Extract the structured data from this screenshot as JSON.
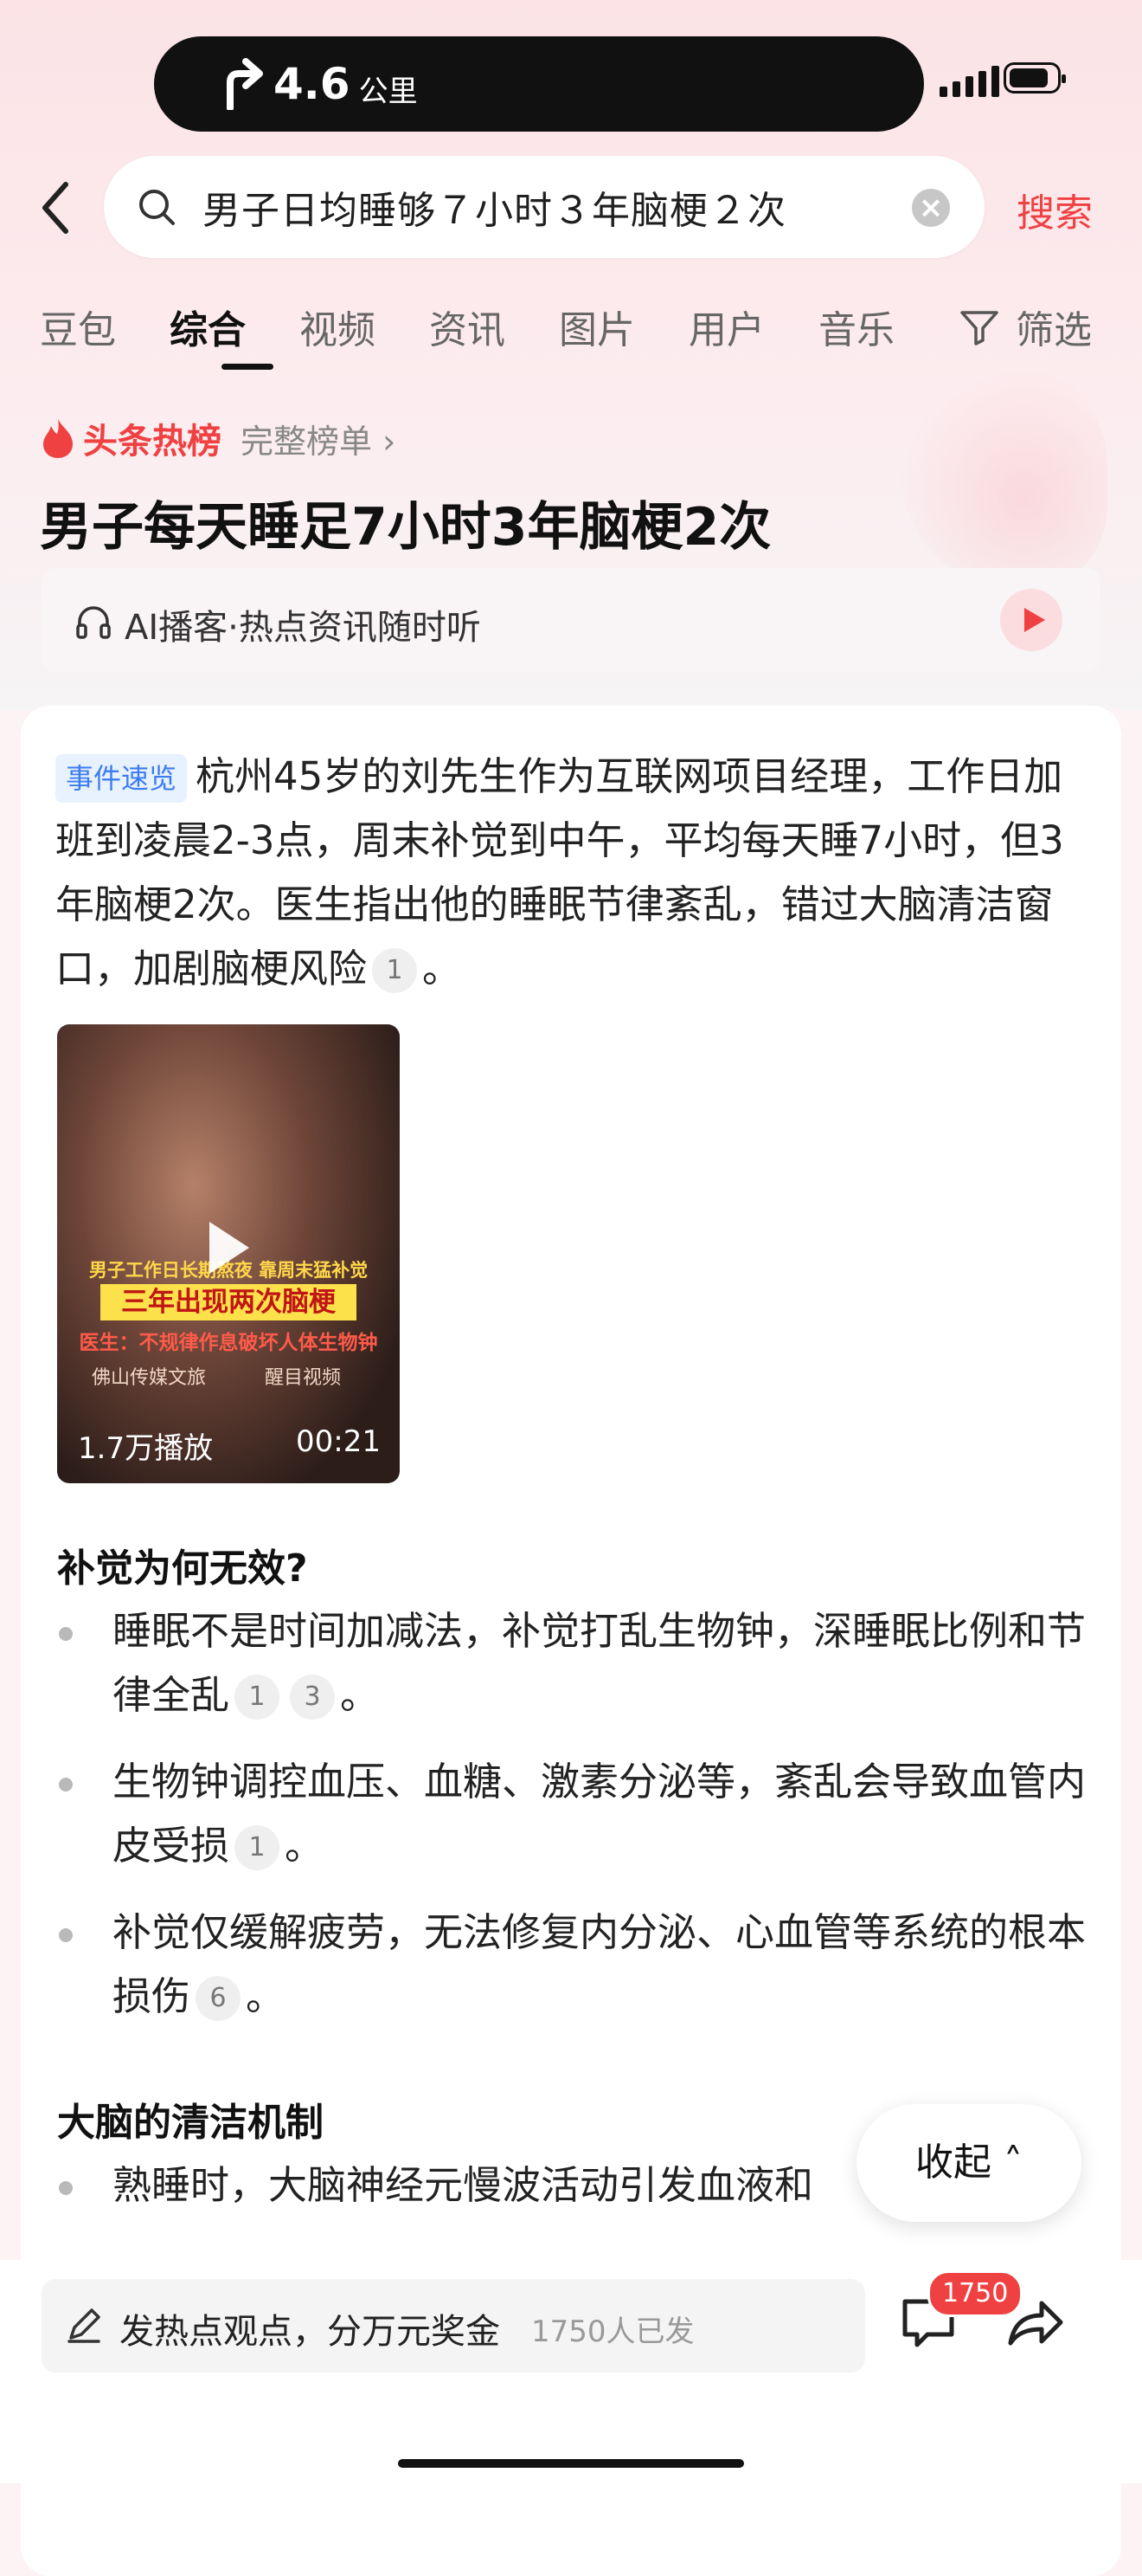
{
  "status": {
    "distance": "4.6",
    "unit": "公里"
  },
  "search": {
    "query": "男子日均睡够７小时３年脑梗２次",
    "button_label": "搜索"
  },
  "tabs": [
    "豆包",
    "综合",
    "视频",
    "资讯",
    "图片",
    "用户",
    "音乐",
    "筛选"
  ],
  "active_tab": "综合",
  "hot": {
    "label": "头条热榜",
    "full_rank": "完整榜单 ›"
  },
  "title": "男子每天睡足7小时3年脑梗2次",
  "ai_podcast": {
    "text": "AI播客·热点资讯随时听"
  },
  "summary": {
    "tag": "事件速览",
    "text": "杭州45岁的刘先生作为互联网项目经理，工作日加班到凌晨2-3点，周末补觉到中午，平均每天睡7小时，但3年脑梗2次。医生指出他的睡眠节律紊乱，错过大脑清洁窗口，加剧脑梗风险",
    "cite": "1",
    "end": "。"
  },
  "video": {
    "caption_line1": "男子工作日长期熬夜 靠周末猛补觉",
    "caption_line2": "三年出现两次脑梗",
    "caption_line3": "医生：不规律作息破坏人体生物钟",
    "source1": "佛山传媒文旅",
    "source2": "醒目视频",
    "plays": "1.7万播放",
    "duration": "00:21"
  },
  "section1": {
    "heading": "补觉为何无效?",
    "bullets": [
      {
        "text": "睡眠不是时间加减法，补觉打乱生物钟，深睡眠比例和节律全乱",
        "cites": [
          "1",
          "3"
        ],
        "end": "。"
      },
      {
        "text": "生物钟调控血压、血糖、激素分泌等，紊乱会导致血管内皮受损",
        "cites": [
          "1"
        ],
        "end": "。"
      },
      {
        "text": "补觉仅缓解疲劳，无法修复内分泌、心血管等系统的根本损伤",
        "cites": [
          "6"
        ],
        "end": "。"
      }
    ]
  },
  "section2": {
    "heading": "大脑的清洁机制",
    "bullets": [
      {
        "text": "熟睡时，大脑神经元慢波活动引发血液和"
      }
    ]
  },
  "collapse": {
    "label": "收起 ˄"
  },
  "bottom": {
    "post_text": "发热点观点，分万元奖金",
    "post_count": "1750人已发",
    "comment_badge": "1750"
  },
  "colors": {
    "accent": "#f04142",
    "tag_blue": "#3b7cf0"
  }
}
